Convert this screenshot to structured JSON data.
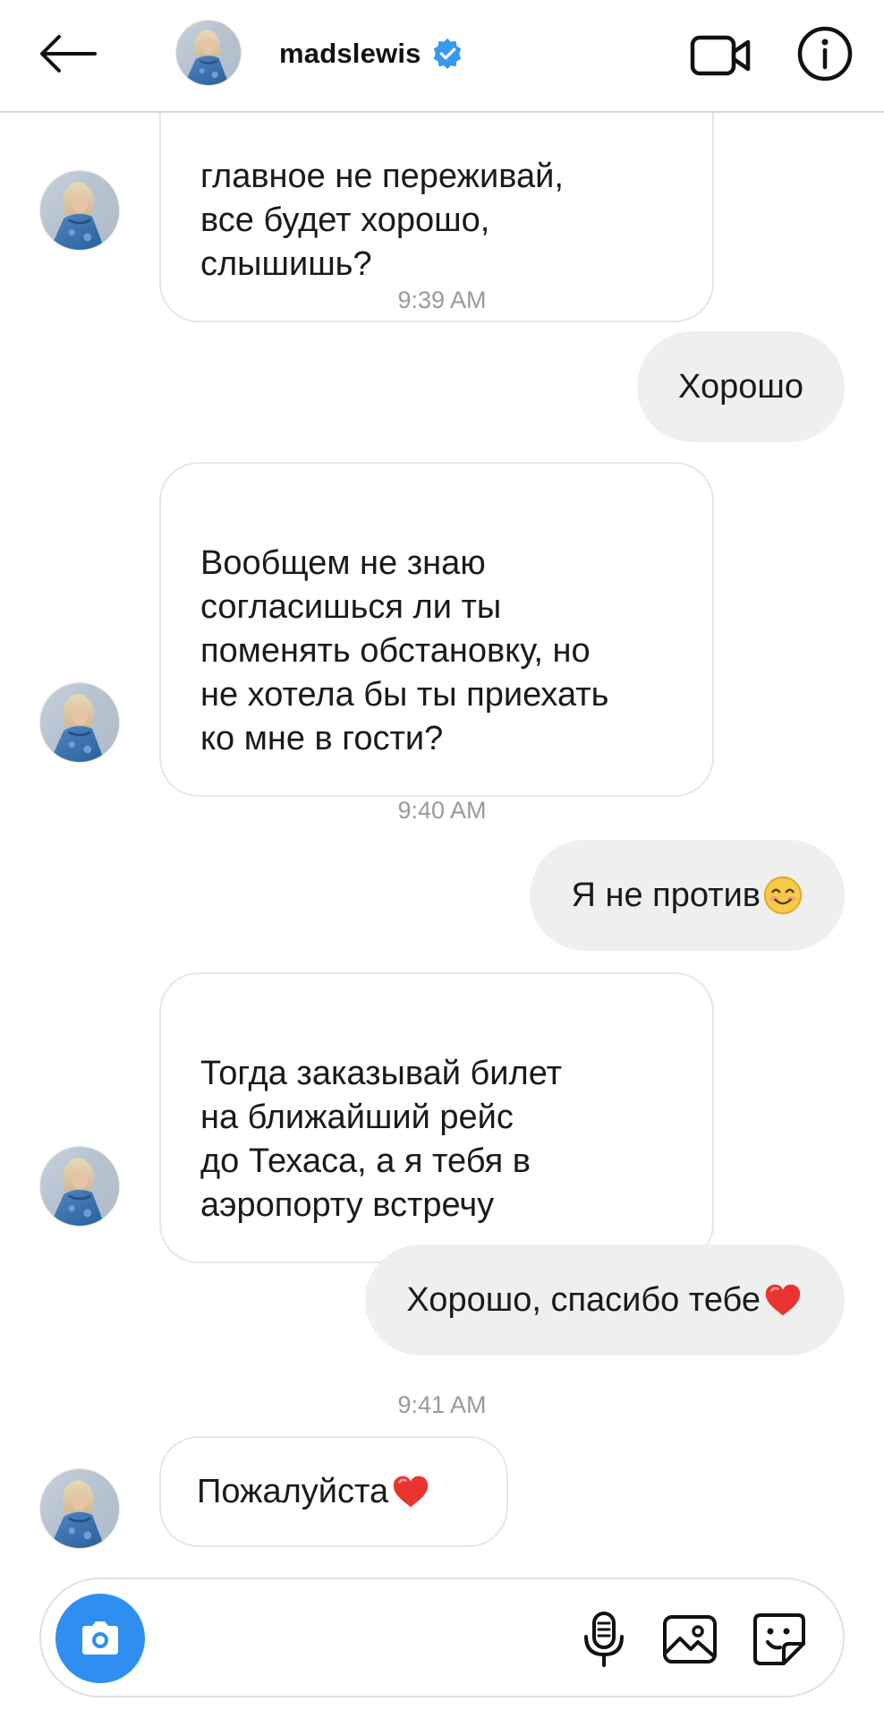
{
  "header": {
    "username": "madslewis",
    "verified": true,
    "icons": {
      "back": "arrow-left-icon",
      "video": "video-camera-icon",
      "info": "info-icon",
      "verified": "verified-badge-icon"
    }
  },
  "messages": [
    {
      "sender": "them",
      "text": "главное не переживай,\nвсе будет хорошо,\nслышишь?"
    },
    {
      "type": "timestamp",
      "text": "9:39 AM"
    },
    {
      "sender": "me",
      "text": "Хорошо"
    },
    {
      "sender": "them",
      "text": "Вообщем не знаю\nсогласишься ли ты\nпоменять обстановку, но\nне хотела бы ты приехать\nко мне в гости?"
    },
    {
      "type": "timestamp",
      "text": "9:40 AM"
    },
    {
      "sender": "me",
      "text": "Я не против",
      "emoji": "smiling-face-emoji"
    },
    {
      "sender": "them",
      "text": "Тогда заказывай билет\nна ближайший рейс\nдо Техаса, а я тебя в\nаэропорту встречу"
    },
    {
      "sender": "me",
      "text": "Хорошо, спасибо тебе",
      "emoji": "red-heart-emoji"
    },
    {
      "type": "timestamp",
      "text": "9:41 AM"
    },
    {
      "sender": "them",
      "text": "Пожалуйста",
      "emoji": "red-heart-emoji"
    }
  ],
  "composer": {
    "value": "",
    "icons": {
      "camera": "camera-icon",
      "mic": "microphone-icon",
      "gallery": "gallery-icon",
      "sticker": "sticker-icon"
    }
  },
  "colors": {
    "accent": "#2f8ff0",
    "verified": "#3897f0",
    "outgoing_bubble": "#efefef",
    "incoming_border": "#e7e7e7",
    "timestamp": "#9a9a9a",
    "heart": "#e8332e",
    "smiley": "#f7c948"
  }
}
